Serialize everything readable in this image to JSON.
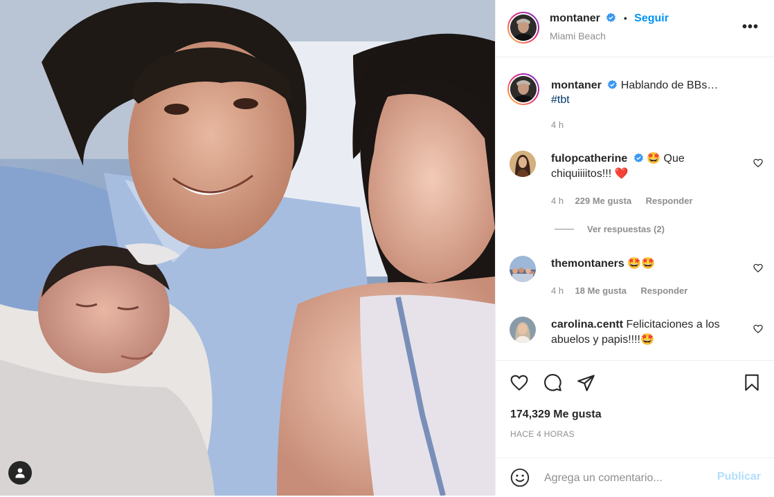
{
  "post": {
    "author": "montaner",
    "follow_label": "Seguir",
    "location": "Miami Beach",
    "caption": "Hablando de BBs…",
    "hashtag": "#tbt",
    "caption_time": "4 h",
    "likes": "174,329 Me gusta",
    "posted_ago": "HACE 4 HORAS"
  },
  "comments": [
    {
      "user": "fulopcatherine",
      "text_line1": "🤩 Que",
      "text_line2": "chiquiiiitos!!! ❤️",
      "time": "4 h",
      "likes": "229 Me gusta",
      "reply": "Responder",
      "view_replies": "Ver respuestas (2)"
    },
    {
      "user": "themontaners",
      "text_line1": "🤩🤩",
      "time": "4 h",
      "likes": "18 Me gusta",
      "reply": "Responder"
    },
    {
      "user": "carolina.centt",
      "text_line1": "Felicitaciones a los",
      "text_line2": "abuelos y papis!!!!🤩"
    }
  ],
  "comment_box": {
    "placeholder": "Agrega un comentario...",
    "publish": "Publicar"
  },
  "colors": {
    "accent": "#0095f6",
    "text": "#262626",
    "muted": "#8e8e8e",
    "like_red": "#ed4956"
  },
  "icons": [
    "user-tag-icon",
    "verified-badge-icon",
    "more-options-icon",
    "heart-icon",
    "comment-icon",
    "share-icon",
    "bookmark-icon",
    "emoji-icon"
  ]
}
